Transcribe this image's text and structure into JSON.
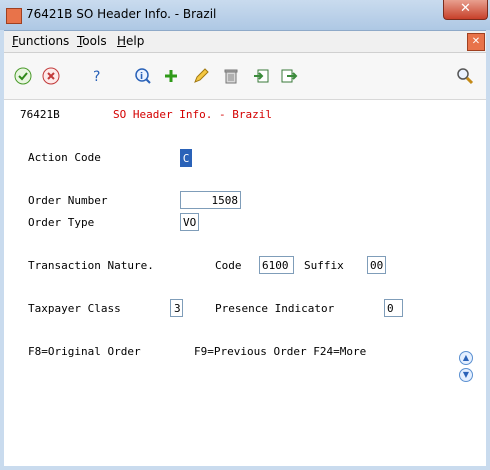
{
  "window": {
    "title": "76421B   SO Header Info. - Brazil",
    "close_glyph": "✕"
  },
  "menu": {
    "items": [
      {
        "accel": "F",
        "rest": "unctions"
      },
      {
        "accel": "T",
        "rest": "ools"
      },
      {
        "accel": "H",
        "rest": "elp"
      }
    ]
  },
  "toolbar": {
    "icons": [
      "ok-icon",
      "cancel-icon",
      "help-icon",
      "inquire-icon",
      "add-icon",
      "edit-icon",
      "delete-icon",
      "import-icon",
      "export-icon",
      "search-icon"
    ]
  },
  "form": {
    "program_id": "76421B",
    "form_title": "SO Header Info. - Brazil",
    "action_code_label": "Action Code",
    "action_code_value": "C",
    "order_number_label": "Order Number",
    "order_number_value": "1508",
    "order_type_label": "Order Type",
    "order_type_value": "VO",
    "transaction_nature_label": "Transaction Nature.",
    "code_label": "Code",
    "code_value": "6100",
    "suffix_label": "Suffix",
    "suffix_value": "00",
    "taxpayer_class_label": "Taxpayer Class",
    "taxpayer_class_value": "3",
    "presence_indicator_label": "Presence Indicator",
    "presence_indicator_value": "0",
    "footer_f8": "F8=Original Order",
    "footer_f9_f24": "F9=Previous Order F24=More"
  },
  "colors": {
    "accent_red": "#d40000",
    "title_bar": "#c9dbee"
  }
}
